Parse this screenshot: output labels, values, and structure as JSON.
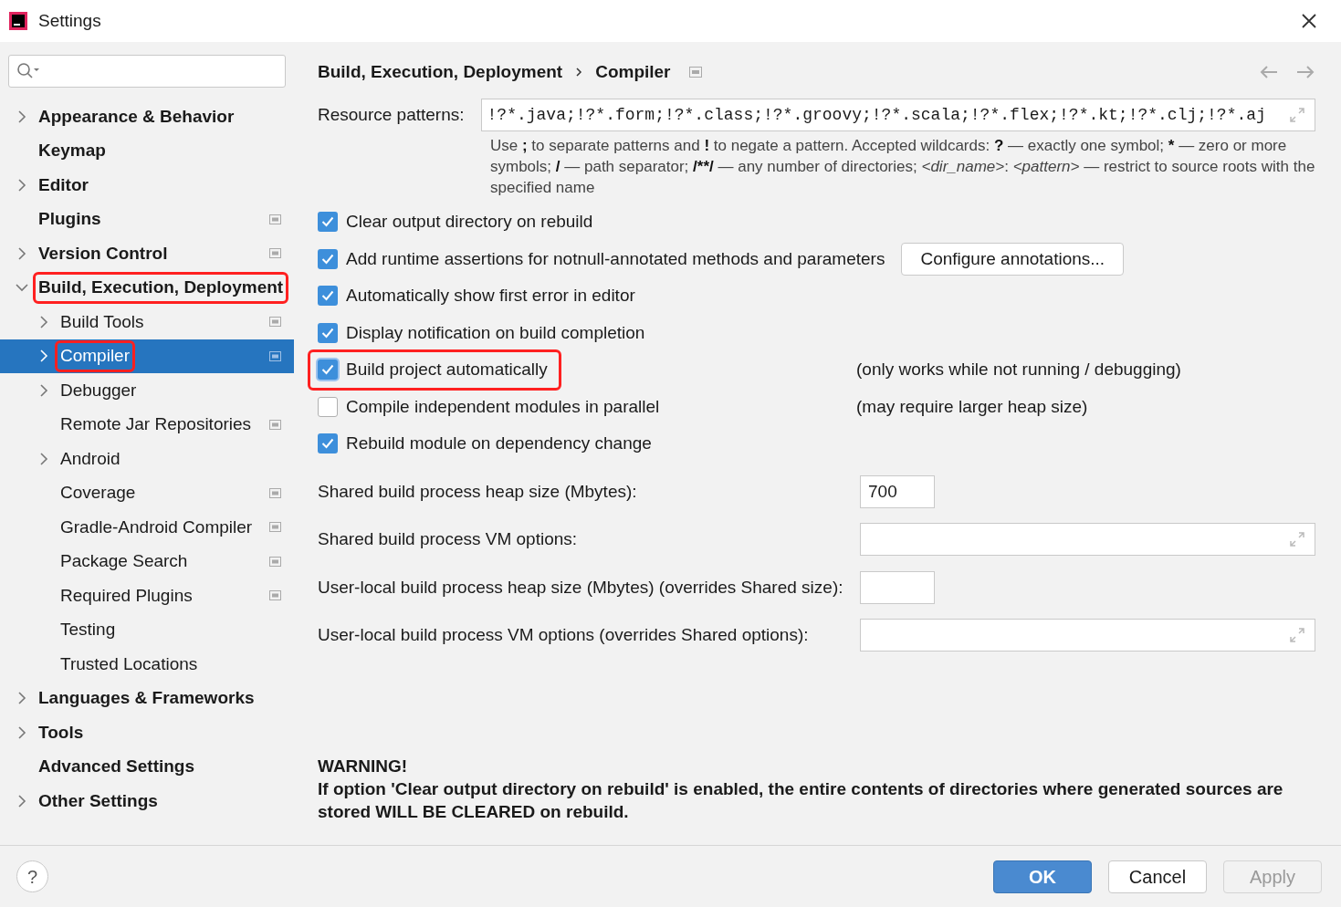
{
  "window": {
    "title": "Settings"
  },
  "sidebar": {
    "items": [
      {
        "label": "Appearance & Behavior",
        "expandable": true,
        "expanded": false,
        "selected": false,
        "highlighted": false,
        "project_icon": false
      },
      {
        "label": "Keymap",
        "expandable": false,
        "selected": false,
        "highlighted": false,
        "project_icon": false
      },
      {
        "label": "Editor",
        "expandable": true,
        "expanded": false,
        "selected": false,
        "highlighted": false,
        "project_icon": false
      },
      {
        "label": "Plugins",
        "expandable": false,
        "selected": false,
        "highlighted": false,
        "project_icon": true
      },
      {
        "label": "Version Control",
        "expandable": true,
        "expanded": false,
        "selected": false,
        "highlighted": false,
        "project_icon": true
      },
      {
        "label": "Build, Execution, Deployment",
        "expandable": true,
        "expanded": true,
        "selected": false,
        "highlighted": true,
        "project_icon": false,
        "children": [
          {
            "label": "Build Tools",
            "expandable": true,
            "expanded": false,
            "selected": false,
            "highlighted": false,
            "project_icon": true
          },
          {
            "label": "Compiler",
            "expandable": true,
            "expanded": false,
            "selected": true,
            "highlighted": true,
            "project_icon": true
          },
          {
            "label": "Debugger",
            "expandable": true,
            "expanded": false,
            "selected": false,
            "highlighted": false,
            "project_icon": false
          },
          {
            "label": "Remote Jar Repositories",
            "expandable": false,
            "selected": false,
            "highlighted": false,
            "project_icon": true
          },
          {
            "label": "Android",
            "expandable": true,
            "expanded": false,
            "selected": false,
            "highlighted": false,
            "project_icon": false
          },
          {
            "label": "Coverage",
            "expandable": false,
            "selected": false,
            "highlighted": false,
            "project_icon": true
          },
          {
            "label": "Gradle-Android Compiler",
            "expandable": false,
            "selected": false,
            "highlighted": false,
            "project_icon": true
          },
          {
            "label": "Package Search",
            "expandable": false,
            "selected": false,
            "highlighted": false,
            "project_icon": true
          },
          {
            "label": "Required Plugins",
            "expandable": false,
            "selected": false,
            "highlighted": false,
            "project_icon": true
          },
          {
            "label": "Testing",
            "expandable": false,
            "selected": false,
            "highlighted": false,
            "project_icon": false
          },
          {
            "label": "Trusted Locations",
            "expandable": false,
            "selected": false,
            "highlighted": false,
            "project_icon": false
          }
        ]
      },
      {
        "label": "Languages & Frameworks",
        "expandable": true,
        "expanded": false,
        "selected": false,
        "highlighted": false,
        "project_icon": false
      },
      {
        "label": "Tools",
        "expandable": true,
        "expanded": false,
        "selected": false,
        "highlighted": false,
        "project_icon": false
      },
      {
        "label": "Advanced Settings",
        "expandable": false,
        "selected": false,
        "highlighted": false,
        "project_icon": false
      },
      {
        "label": "Other Settings",
        "expandable": true,
        "expanded": false,
        "selected": false,
        "highlighted": false,
        "project_icon": false
      }
    ]
  },
  "breadcrumb": [
    "Build, Execution, Deployment",
    "Compiler"
  ],
  "resource_patterns": {
    "label": "Resource patterns:",
    "value": "!?*.java;!?*.form;!?*.class;!?*.groovy;!?*.scala;!?*.flex;!?*.kt;!?*.clj;!?*.aj",
    "help": [
      {
        "kind": "plain",
        "text": "Use "
      },
      {
        "kind": "bold",
        "text": ";"
      },
      {
        "kind": "plain",
        "text": " to separate patterns and "
      },
      {
        "kind": "bold",
        "text": "!"
      },
      {
        "kind": "plain",
        "text": " to negate a pattern. Accepted wildcards: "
      },
      {
        "kind": "bold",
        "text": "?"
      },
      {
        "kind": "plain",
        "text": " — exactly one symbol; "
      },
      {
        "kind": "bold",
        "text": "*"
      },
      {
        "kind": "plain",
        "text": " — zero or more symbols; "
      },
      {
        "kind": "bold",
        "text": "/"
      },
      {
        "kind": "plain",
        "text": " — path separator; "
      },
      {
        "kind": "bold",
        "text": "/**/"
      },
      {
        "kind": "plain",
        "text": " — any number of directories;  "
      },
      {
        "kind": "italic",
        "text": "<dir_name>"
      },
      {
        "kind": "plain",
        "text": ": "
      },
      {
        "kind": "italic",
        "text": "<pattern>"
      },
      {
        "kind": "plain",
        "text": " — restrict to source roots with the specified name"
      }
    ]
  },
  "options": [
    {
      "label": "Clear output directory on rebuild",
      "checked": true
    },
    {
      "label": "Add runtime assertions for notnull-annotated methods and parameters",
      "checked": true,
      "button": "Configure annotations..."
    },
    {
      "label": "Automatically show first error in editor",
      "checked": true
    },
    {
      "label": "Display notification on build completion",
      "checked": true
    },
    {
      "label": "Build project automatically",
      "checked": true,
      "highlighted": true,
      "note": "(only works while not running / debugging)"
    },
    {
      "label": "Compile independent modules in parallel",
      "checked": false,
      "note": "(may require larger heap size)"
    },
    {
      "label": "Rebuild module on dependency change",
      "checked": true
    }
  ],
  "fields": [
    {
      "kind": "short",
      "label": "Shared build process heap size (Mbytes):",
      "value": "700"
    },
    {
      "kind": "expandable",
      "label": "Shared build process VM options:"
    },
    {
      "kind": "short",
      "label": "User-local build process heap size (Mbytes) (overrides Shared size):"
    },
    {
      "kind": "expandable",
      "label": "User-local build process VM options (overrides Shared options):"
    }
  ],
  "warning": {
    "title": "WARNING!",
    "text": "If option 'Clear output directory on rebuild' is enabled, the entire contents of directories where generated sources are stored WILL BE CLEARED on rebuild."
  },
  "buttons": [
    {
      "label": "OK",
      "kind": "primary",
      "disabled": false
    },
    {
      "label": "Cancel",
      "kind": "normal",
      "disabled": false
    },
    {
      "label": "Apply",
      "kind": "normal",
      "disabled": true
    }
  ],
  "help_button": "?"
}
